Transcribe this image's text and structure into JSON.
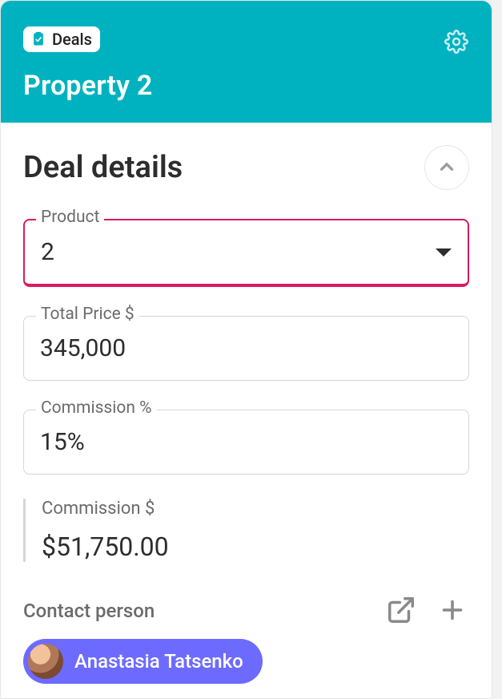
{
  "header": {
    "badge_label": "Deals",
    "title": "Property 2"
  },
  "section": {
    "title": "Deal details"
  },
  "fields": {
    "product": {
      "label": "Product",
      "value": "2"
    },
    "total_price": {
      "label": "Total Price $",
      "value": "345,000"
    },
    "commission_pct": {
      "label": "Commission %",
      "value": "15%"
    },
    "commission_amt": {
      "label": "Commission $",
      "value": "$51,750.00"
    }
  },
  "contact": {
    "label": "Contact person",
    "person_name": "Anastasia Tatsenko"
  }
}
